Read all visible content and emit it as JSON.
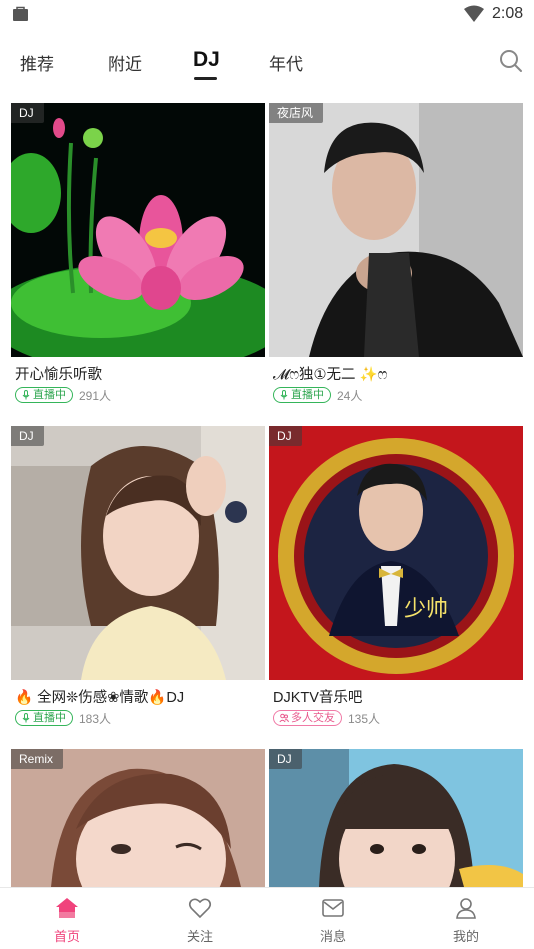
{
  "status_bar": {
    "time": "2:08"
  },
  "tabs": [
    {
      "label": "推荐",
      "active": false
    },
    {
      "label": "附近",
      "active": false
    },
    {
      "label": "DJ",
      "active": true
    },
    {
      "label": "年代",
      "active": false
    }
  ],
  "cards": [
    {
      "badge": "DJ",
      "title": "开心愉乐听歌",
      "status": "直播中",
      "status_type": "live",
      "count": "291人"
    },
    {
      "badge": "夜店风",
      "title": "𝓜ෆ独①无二 ✨ෆ",
      "status": "直播中",
      "status_type": "live",
      "count": "24人"
    },
    {
      "badge": "DJ",
      "title": "🔥 全网❊伤感❀情歌🔥DJ",
      "status": "直播中",
      "status_type": "live",
      "count": "183人"
    },
    {
      "badge": "DJ",
      "title": "DJKTV音乐吧",
      "status": "多人交友",
      "status_type": "social",
      "count": "135人",
      "image_text": "少帅"
    },
    {
      "badge": "Remix"
    },
    {
      "badge": "DJ"
    }
  ],
  "bottom_nav": [
    {
      "label": "首页",
      "icon": "home-icon",
      "active": true
    },
    {
      "label": "关注",
      "icon": "heart-icon",
      "active": false
    },
    {
      "label": "消息",
      "icon": "mail-icon",
      "active": false
    },
    {
      "label": "我的",
      "icon": "person-icon",
      "active": false
    }
  ],
  "colors": {
    "accent": "#f0437c",
    "live_green": "#35b55a"
  }
}
